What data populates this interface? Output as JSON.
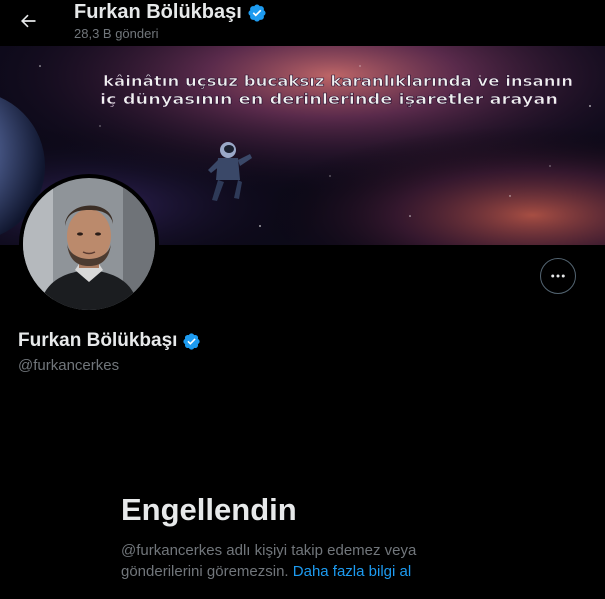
{
  "header": {
    "back_icon": "arrow-left-icon",
    "title": "Furkan Bölükbaşı",
    "post_count": "28,3 B gönderi"
  },
  "banner": {
    "line1": "kâinâtın uçsuz bucaksız karanlıklarında ve insanın",
    "line2": "iç dünyasının en derinlerinde işaretler arayan"
  },
  "profile": {
    "name": "Furkan Bölükbaşı",
    "handle": "@furkancerkes",
    "verified_icon": "verified-badge-icon",
    "more_icon": "more-dots-icon"
  },
  "blocked": {
    "title": "Engellendin",
    "message": "@furkancerkes adlı kişiyi takip edemez veya gönderilerini göremezsin.",
    "link": "Daha fazla bilgi al"
  },
  "colors": {
    "background": "#000000",
    "text": "#e7e9ea",
    "muted": "#71767b",
    "accent": "#1d9bf0"
  }
}
